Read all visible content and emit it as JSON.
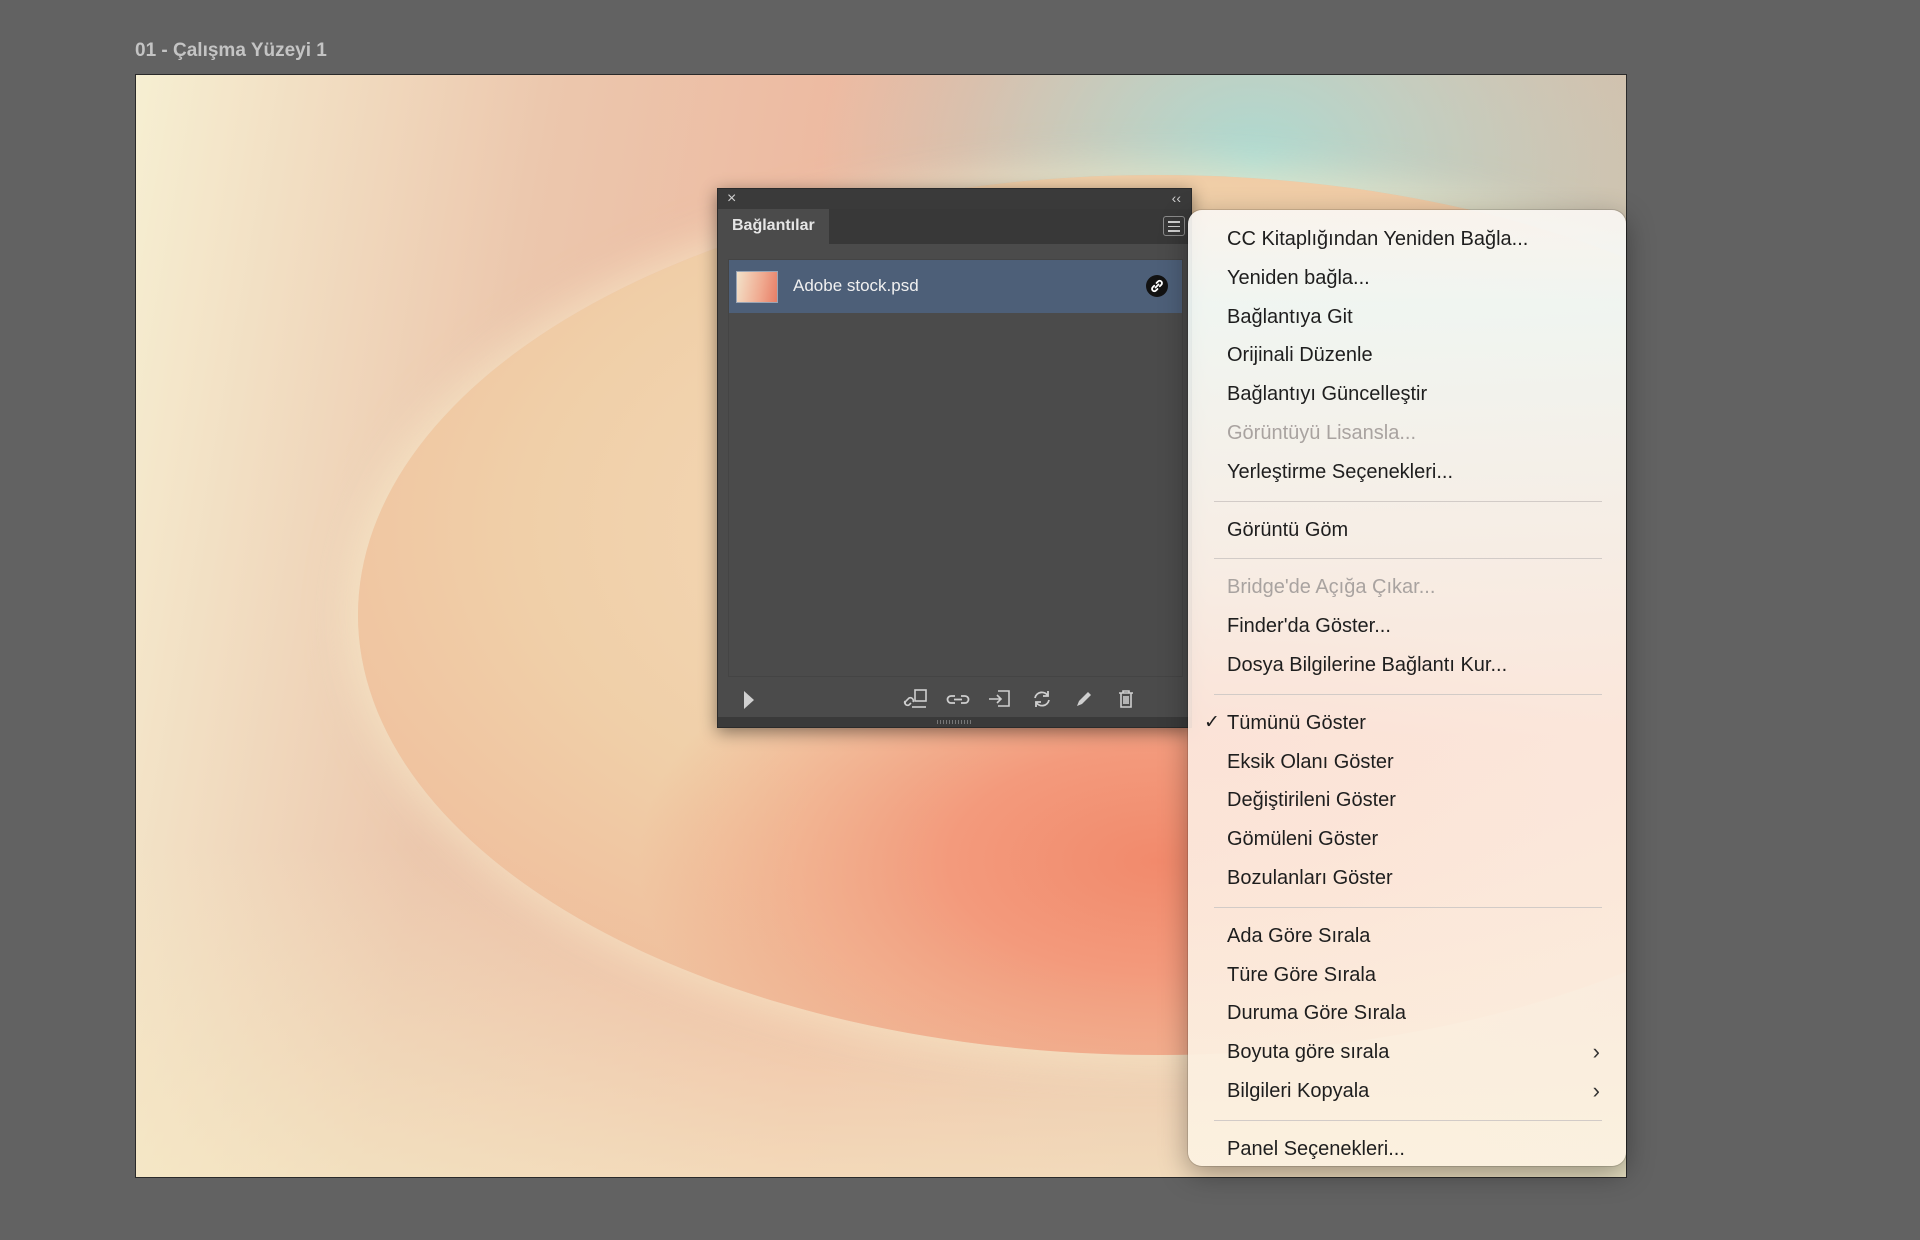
{
  "artboard": {
    "label": "01 - Çalışma Yüzeyi 1"
  },
  "panel": {
    "close_icon": "×",
    "collapse_icon": "‹‹",
    "tab_label": "Bağlantılar",
    "links": [
      {
        "name": "Adobe stock.psd",
        "status_icon": "link-icon"
      }
    ],
    "toolbar_icons": [
      "relink-cc-library-icon",
      "relink-icon",
      "go-to-link-icon",
      "update-link-icon",
      "edit-original-icon",
      "trash-icon"
    ]
  },
  "context_menu": {
    "groups": [
      [
        {
          "label": "CC Kitaplığından Yeniden Bağla...",
          "enabled": true
        },
        {
          "label": "Yeniden bağla...",
          "enabled": true
        },
        {
          "label": "Bağlantıya Git",
          "enabled": true
        },
        {
          "label": "Orijinali Düzenle",
          "enabled": true
        },
        {
          "label": "Bağlantıyı Güncelleştir",
          "enabled": true
        },
        {
          "label": "Görüntüyü Lisansla...",
          "enabled": false
        },
        {
          "label": "Yerleştirme Seçenekleri...",
          "enabled": true
        }
      ],
      [
        {
          "label": "Görüntü Göm",
          "enabled": true
        }
      ],
      [
        {
          "label": "Bridge'de Açığa Çıkar...",
          "enabled": false
        },
        {
          "label": "Finder'da Göster...",
          "enabled": true
        },
        {
          "label": "Dosya Bilgilerine Bağlantı Kur...",
          "enabled": true
        }
      ],
      [
        {
          "label": "Tümünü Göster",
          "enabled": true,
          "checked": true
        },
        {
          "label": "Eksik Olanı Göster",
          "enabled": true
        },
        {
          "label": "Değiştirileni Göster",
          "enabled": true
        },
        {
          "label": "Gömüleni Göster",
          "enabled": true
        },
        {
          "label": "Bozulanları Göster",
          "enabled": true
        }
      ],
      [
        {
          "label": "Ada Göre Sırala",
          "enabled": true
        },
        {
          "label": "Türe Göre Sırala",
          "enabled": true
        },
        {
          "label": "Duruma Göre Sırala",
          "enabled": true
        },
        {
          "label": "Boyuta göre sırala",
          "enabled": true,
          "submenu": true
        },
        {
          "label": "Bilgileri Kopyala",
          "enabled": true,
          "submenu": true
        }
      ],
      [
        {
          "label": "Panel Seçenekleri...",
          "enabled": true
        }
      ]
    ],
    "check_glyph": "✓",
    "submenu_glyph": "›"
  }
}
